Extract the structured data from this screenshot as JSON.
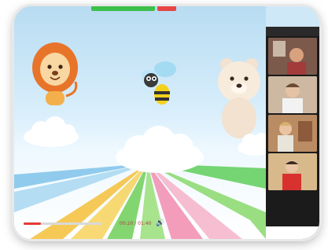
{
  "topbar": {
    "left": "",
    "right": ""
  },
  "player": {
    "time": "00:20 / 01:40",
    "progress": 0.22,
    "speaker_glyph": "🔊"
  },
  "meeting": {
    "header_left": "",
    "header_right": "",
    "participants": [
      {
        "name": ""
      },
      {
        "name": ""
      },
      {
        "name": ""
      },
      {
        "name": ""
      },
      {
        "name": ""
      }
    ],
    "footer_labels": [
      "",
      "",
      ""
    ]
  },
  "colors": {
    "accent": "#e53935",
    "stage_sky": "#b8dcf2",
    "panel_bg": "#1b1b1b"
  }
}
